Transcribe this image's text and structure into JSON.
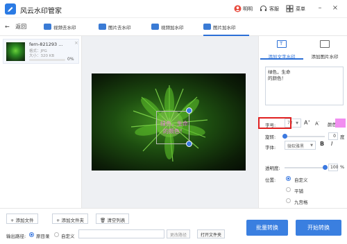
{
  "app": {
    "title": "风云水印管家"
  },
  "topbar": {
    "member_label": "明明",
    "service_label": "客服",
    "menu_label": "菜单"
  },
  "nav": {
    "back_label": "返回",
    "tabs": [
      {
        "label": "视频去水印"
      },
      {
        "label": "图片去水印"
      },
      {
        "label": "视频加水印"
      },
      {
        "label": "图片加水印"
      }
    ]
  },
  "file": {
    "name": "fern-821293 ...",
    "format": "格式：JPG",
    "size": "大小：320 KB",
    "progress_label": "0%",
    "progress_value": 0
  },
  "canvas": {
    "watermark_text": "绿色，生命\n的颜色！",
    "watermark_color": "#e57bd8"
  },
  "panel": {
    "tabs": [
      {
        "label": "添加文字水印"
      },
      {
        "label": "添加图片水印"
      }
    ],
    "text_value": "绿色，生命\n的颜色！",
    "font_label": "字体:",
    "font_value": "微软雅黑",
    "bold_label": "B",
    "italic_label": "I",
    "size_label": "字号:",
    "size_value": "72",
    "size_up_label": "A",
    "size_down_label": "A",
    "color_label": "颜色:",
    "color_value": "#f18ef0",
    "rotate_label": "旋转:",
    "rotate_value": "0",
    "rotate_unit": "度",
    "rotate_fraction": 0.0,
    "opacity_label": "透明度:",
    "opacity_value": "100",
    "opacity_unit": "%",
    "opacity_fraction": 1.0,
    "position_label": "位置:",
    "position_options": [
      "自定义",
      "平铺",
      "九宫格"
    ],
    "position_selected": 0
  },
  "bottom": {
    "add_file_label": "添加文件",
    "add_folder_label": "添加文件夹",
    "clear_list_label": "清空列表",
    "output_path_label": "输出路径:",
    "original_dir_label": "原目录",
    "custom_label": "自定义",
    "change_path_label": "更改路径",
    "open_folder_label": "打开文件夹",
    "batch_convert_label": "批量转换",
    "start_convert_label": "开始转换"
  },
  "colors": {
    "accent": "#2b6fd6",
    "highlight_border": "#e02020"
  }
}
